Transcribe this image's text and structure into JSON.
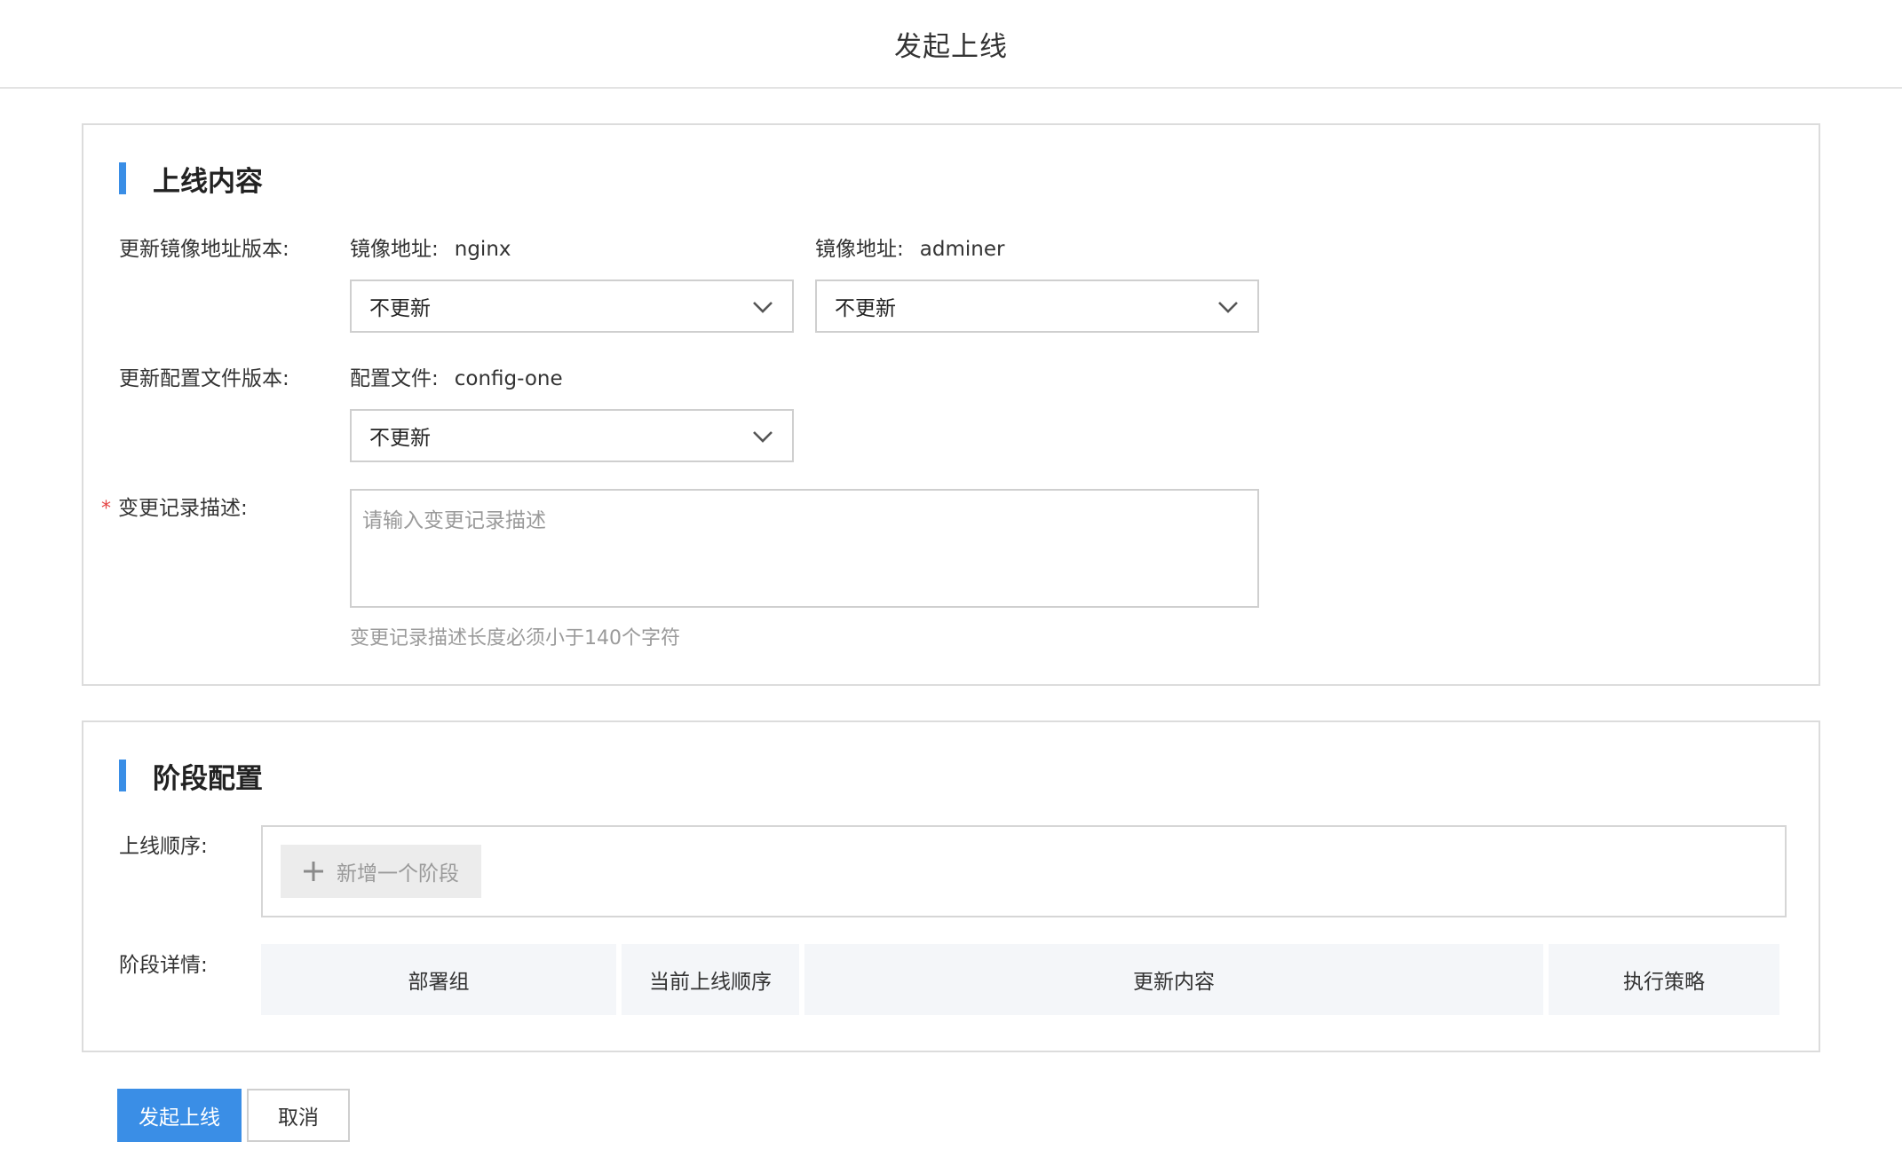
{
  "header": {
    "title": "发起上线"
  },
  "content_section": {
    "title": "上线内容",
    "image_version": {
      "label": "更新镜像地址版本:",
      "fields": [
        {
          "caption": "镜像地址:",
          "value": "nginx",
          "selected": "不更新"
        },
        {
          "caption": "镜像地址:",
          "value": "adminer",
          "selected": "不更新"
        }
      ]
    },
    "config_version": {
      "label": "更新配置文件版本:",
      "fields": [
        {
          "caption": "配置文件:",
          "value": "config-one",
          "selected": "不更新"
        }
      ]
    },
    "change_record": {
      "required_mark": "*",
      "label": "变更记录描述:",
      "placeholder": "请输入变更记录描述",
      "value": "",
      "hint": "变更记录描述长度必须小于140个字符"
    }
  },
  "stage_section": {
    "title": "阶段配置",
    "order_label": "上线顺序:",
    "add_stage_label": "新增一个阶段",
    "detail_label": "阶段详情:",
    "columns": [
      "部署组",
      "当前上线顺序",
      "更新内容",
      "执行策略"
    ]
  },
  "actions": {
    "submit": "发起上线",
    "cancel": "取消"
  },
  "colors": {
    "accent": "#3a8ee6",
    "required": "#e54545",
    "table_header_bg": "#f4f6f9"
  },
  "icons": {
    "dropdown": "chevron-down-icon",
    "add": "plus-icon"
  }
}
